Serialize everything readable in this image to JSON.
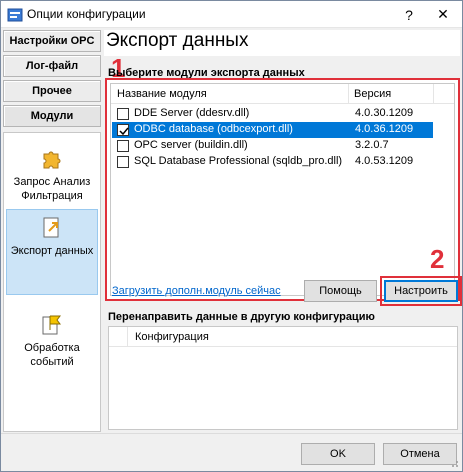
{
  "window": {
    "title": "Опции конфигурации",
    "help_glyph": "?",
    "close_glyph": "✕"
  },
  "sidebar": {
    "tabs": [
      {
        "label": "Настройки OPC"
      },
      {
        "label": "Лог-файл"
      },
      {
        "label": "Прочее"
      },
      {
        "label": "Модули"
      }
    ],
    "modules": [
      {
        "label": "Запрос Анализ Фильтрация",
        "icon": "puzzle-icon"
      },
      {
        "label": "Экспорт данных",
        "icon": "export-icon"
      },
      {
        "label": "Обработка событий",
        "icon": "flag-icon"
      }
    ]
  },
  "main": {
    "page_title": "Экспорт данных",
    "export_section_label": "Выберите модули экспорта данных",
    "columns": {
      "name": "Название модуля",
      "version": "Версия"
    },
    "modules": [
      {
        "name": "DDE Server (ddesrv.dll)",
        "version": "4.0.30.1209",
        "checked": false
      },
      {
        "name": "ODBC database (odbcexport.dll)",
        "version": "4.0.36.1209",
        "checked": true
      },
      {
        "name": "OPC server (buildin.dll)",
        "version": "3.2.0.7",
        "checked": false
      },
      {
        "name": "SQL Database Professional (sqldb_pro.dll)",
        "version": "4.0.53.1209",
        "checked": false
      }
    ],
    "annotation_1": "1",
    "annotation_2": "2",
    "load_link": "Загрузить дополн.модуль сейчас",
    "help_button": "Помощь",
    "configure_button": "Настроить",
    "redirect_section_label": "Перенаправить данные в другую конфигурацию",
    "config_column": "Конфигурация"
  },
  "footer": {
    "ok_button": "OK",
    "cancel_button": "Отмена"
  },
  "colors": {
    "accent": "#0078d7",
    "annotation_red": "#e0303a",
    "link": "#0066cc"
  }
}
